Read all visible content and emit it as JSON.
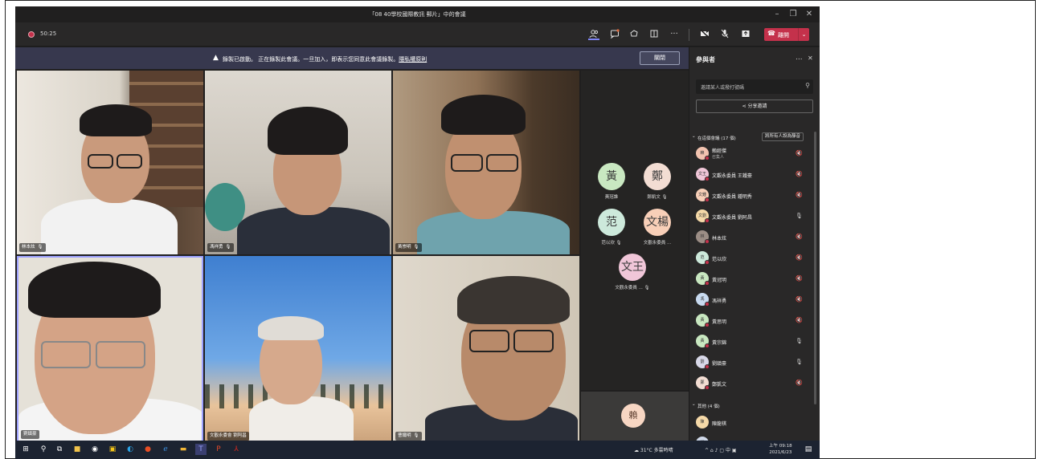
{
  "window": {
    "title": "「08 40學校國際教訊 郵片」中的會議",
    "min": "–",
    "max": "❐",
    "close": "✕"
  },
  "toolbar": {
    "timer": "50:25",
    "leave_label": "離開",
    "icons": [
      "participants-icon",
      "chat-icon",
      "reactions-icon",
      "rooms-icon",
      "more-icon",
      "camera-off-icon",
      "mic-off-icon",
      "share-icon",
      "phone-icon"
    ]
  },
  "banner": {
    "message": "錄製已啟動。 正在錄製此會議。一旦加入，即表示您同意此會議錄製。",
    "link": "隱私權原則",
    "dismiss": "關閉"
  },
  "videos": [
    {
      "name": "林本炫",
      "mic": "🎙"
    },
    {
      "name": "馮祥勇",
      "mic": "🎙"
    },
    {
      "name": "黃崇明",
      "mic": "🎙"
    },
    {
      "name": "劉鎮豪",
      "mic": ""
    },
    {
      "name": "文觀永委會 劉阿昌",
      "mic": ""
    },
    {
      "name": "曹鐵明",
      "mic": "🎙"
    }
  ],
  "audio_tiles": [
    {
      "initial": "黃",
      "name": "黃冠誰",
      "color": "#c9e8c1"
    },
    {
      "initial": "鄭",
      "name": "鄭凱文",
      "color": "#f3ddd3"
    },
    {
      "initial": "范",
      "name": "范以欣",
      "color": "#cde9db"
    },
    {
      "initial": "文楊",
      "name": "文觀永委員 ...",
      "color": "#f8cfb8"
    },
    {
      "initial": "文王",
      "name": "文觀永委員 ...",
      "color": "#f0c6d8"
    }
  ],
  "small_tile": {
    "initial": "賴"
  },
  "participants_panel": {
    "title": "參與者",
    "more": "...",
    "close": "✕",
    "search_placeholder": "邀請某人或撥打號碼",
    "share_invite": "分享邀請",
    "in_meeting_label": "在這個會議 (17 個)",
    "mute_all": "將所有人設為靜音",
    "others_label": "其他 (4 個)",
    "participants": [
      {
        "initial": "賴",
        "name": "賴經傑",
        "role": "召集人",
        "color": "#f2c3b0",
        "mic": "🔇"
      },
      {
        "initial": "文王",
        "name": "文觀永委員 王鐵豪",
        "role": "",
        "color": "#f0c6d8",
        "mic": "🔇"
      },
      {
        "initial": "文鍾",
        "name": "文觀永委員 鍾明秀",
        "role": "",
        "color": "#f8cfb8",
        "mic": "🔇"
      },
      {
        "initial": "文劉",
        "name": "文觀永委員 劉阿昌",
        "role": "",
        "color": "#f5d9a8",
        "mic": "🎙"
      },
      {
        "initial": "林",
        "name": "林本炫",
        "role": "",
        "color": "#9b8d85",
        "mic": "🔇"
      },
      {
        "initial": "范",
        "name": "范以欣",
        "role": "",
        "color": "#cde9db",
        "mic": "🔇"
      },
      {
        "initial": "黃",
        "name": "黃冠明",
        "role": "",
        "color": "#c9e8c1",
        "mic": "🔇"
      },
      {
        "initial": "馮",
        "name": "馮祥勇",
        "role": "",
        "color": "#c8daf0",
        "mic": "🔇"
      },
      {
        "initial": "黃",
        "name": "黃思明",
        "role": "",
        "color": "#c9e8c1",
        "mic": "🔇"
      },
      {
        "initial": "黃",
        "name": "黃宗錦",
        "role": "",
        "color": "#c9e8c1",
        "mic": "🎙"
      },
      {
        "initial": "劉",
        "name": "劉鎮豪",
        "role": "",
        "color": "#d8d8e8",
        "mic": "🎙"
      },
      {
        "initial": "鄭",
        "name": "鄭凱文",
        "role": "",
        "color": "#f3ddd3",
        "mic": "🔇"
      }
    ],
    "others": [
      {
        "initial": "陳",
        "name": "陳龍棋",
        "color": "#f5d9a8"
      },
      {
        "initial": "張",
        "name": "張淑芬",
        "color": "#cfd8e8"
      }
    ]
  },
  "taskbar": {
    "weather": "31°C 多雲時晴",
    "tray": "^ ⌂ ♪ ▢ 中 ▣",
    "time": "上午 09:18",
    "date": "2021/6/23"
  }
}
